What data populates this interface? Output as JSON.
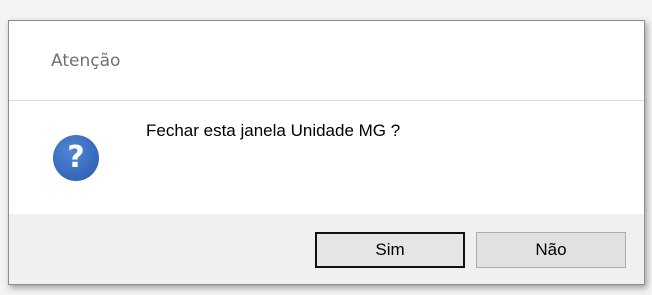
{
  "dialog": {
    "title": "Atenção",
    "icon": "question-icon",
    "message": "Fechar esta janela Unidade MG ?",
    "buttons": {
      "yes_label": "Sim",
      "no_label": "Não"
    }
  },
  "colors": {
    "icon_blue": "#3b6fbf",
    "button_bar": "#f0f0f0",
    "button_face": "#e1e1e1"
  }
}
